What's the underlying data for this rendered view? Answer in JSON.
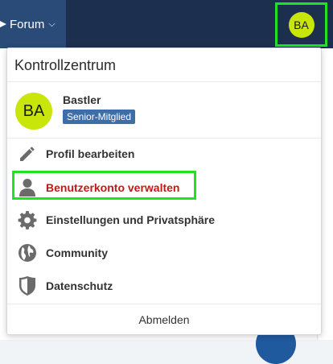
{
  "topbar": {
    "forum_label": "Forum",
    "account_initials": "BA"
  },
  "panel": {
    "title": "Kontrollzentrum",
    "user": {
      "initials": "BA",
      "name": "Bastler",
      "rank": "Senior-Mitglied"
    },
    "items": [
      {
        "label": "Profil bearbeiten",
        "icon": "pencil-icon",
        "active": false
      },
      {
        "label": "Benutzerkonto verwalten",
        "icon": "user-icon",
        "active": true
      },
      {
        "label": "Einstellungen und Privatsphäre",
        "icon": "gear-icon",
        "active": false
      },
      {
        "label": "Community",
        "icon": "globe-icon",
        "active": false
      },
      {
        "label": "Datenschutz",
        "icon": "shield-icon",
        "active": false
      }
    ],
    "logout_label": "Abmelden"
  },
  "colors": {
    "topbar": "#1c2f4e",
    "forum_tab": "#2a4a78",
    "avatar": "#c9e60b",
    "rank_badge": "#3e6ea8",
    "active_text": "#c21818",
    "highlight": "#20e320"
  }
}
